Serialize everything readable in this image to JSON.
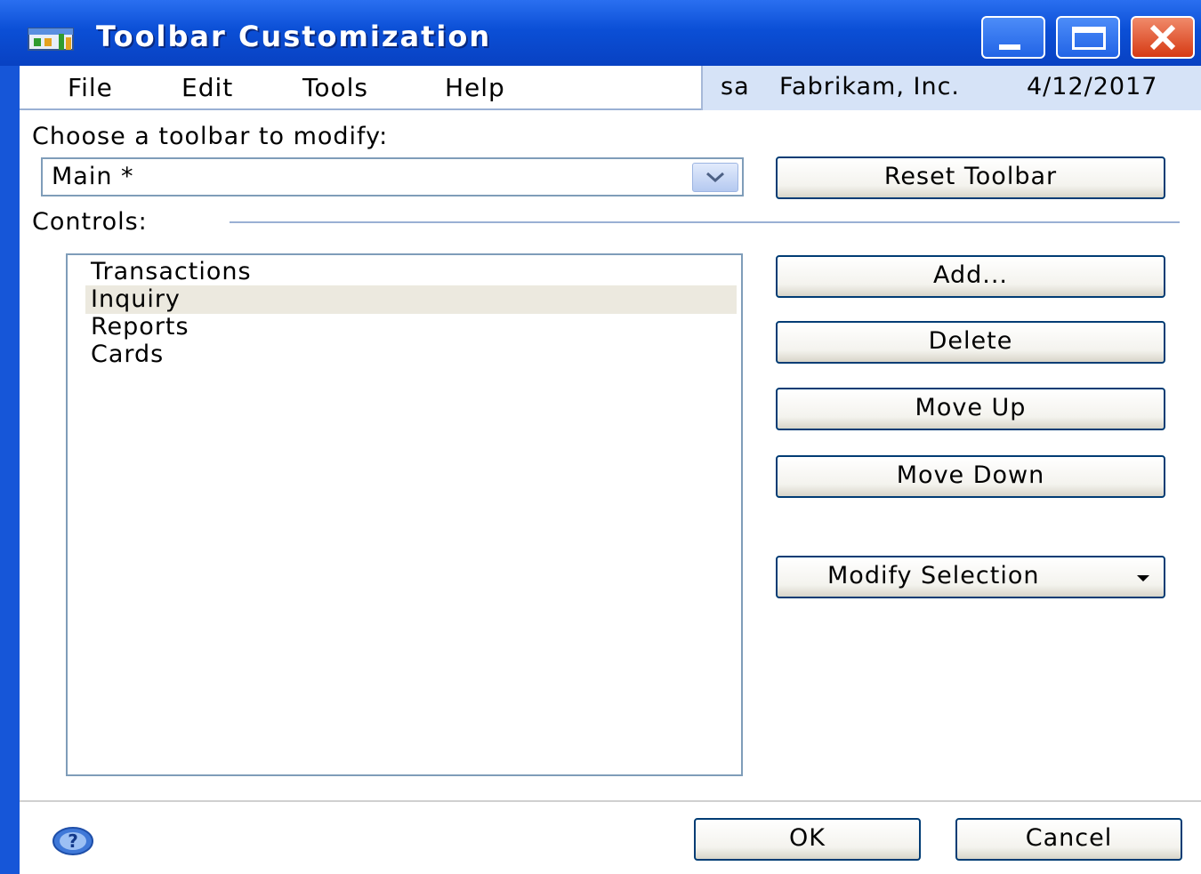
{
  "window": {
    "title": "Toolbar Customization",
    "title_color": "#ffffff",
    "titlebar_color": "#0b4fd6"
  },
  "menubar": {
    "items": [
      "File",
      "Edit",
      "Tools",
      "Help"
    ]
  },
  "userinfo": {
    "user": "sa",
    "company": "Fabrikam, Inc.",
    "date": "4/12/2017"
  },
  "toolbar_select": {
    "label": "Choose a toolbar to modify:",
    "value": "Main *"
  },
  "controls": {
    "label": "Controls:",
    "items": [
      "Transactions",
      "Inquiry",
      "Reports",
      "Cards"
    ],
    "selected": "Inquiry"
  },
  "buttons": {
    "reset_toolbar": "Reset Toolbar",
    "add": "Add...",
    "delete": "Delete",
    "move_up": "Move Up",
    "move_down": "Move Down",
    "modify_selection": "Modify Selection",
    "ok": "OK",
    "cancel": "Cancel"
  },
  "icons": {
    "app": "toolbar-app-icon",
    "help": "help-icon",
    "minimize": "minimize-icon",
    "maximize": "maximize-icon",
    "close": "close-icon",
    "dropdown": "chevron-down-icon"
  }
}
